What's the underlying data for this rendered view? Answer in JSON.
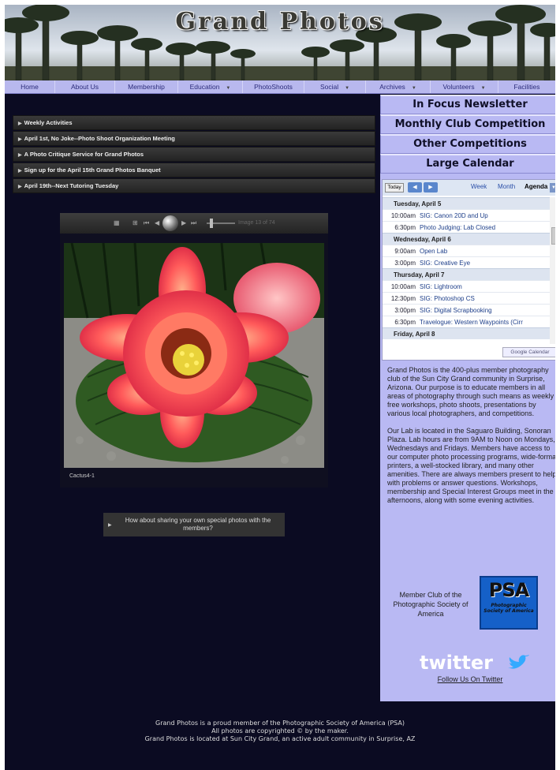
{
  "site": {
    "title": "Grand Photos"
  },
  "nav": {
    "items": [
      {
        "label": "Home",
        "has_dropdown": false
      },
      {
        "label": "About Us",
        "has_dropdown": false
      },
      {
        "label": "Membership",
        "has_dropdown": false
      },
      {
        "label": "Education",
        "has_dropdown": true
      },
      {
        "label": "PhotoShoots",
        "has_dropdown": false
      },
      {
        "label": "Social",
        "has_dropdown": true
      },
      {
        "label": "Archives",
        "has_dropdown": true
      },
      {
        "label": "Volunteers",
        "has_dropdown": true
      },
      {
        "label": "Facilities",
        "has_dropdown": false
      }
    ]
  },
  "accordion": {
    "items": [
      "Weekly Activities",
      "April 1st, No Joke--Photo Shoot Organization Meeting",
      "A Photo Critique Service for Grand Photos",
      "Sign up for the April 15th Grand Photos Banquet",
      "April 19th--Next Tutoring Tuesday"
    ]
  },
  "slideshow": {
    "counter": "Image 13 of 74",
    "caption": "Cactus4-1"
  },
  "share_box": {
    "text": "How about sharing your own special photos with the members?"
  },
  "sidebar": {
    "buttons": [
      "In Focus Newsletter",
      "Monthly Club Competition",
      "Other Competitions",
      "Large Calendar"
    ]
  },
  "calendar": {
    "today_label": "Today",
    "view_week": "Week",
    "view_month": "Month",
    "view_agenda": "Agenda",
    "badge": "Google Calendar",
    "days": [
      {
        "date": "Tuesday, April 5",
        "events": [
          {
            "time": "10:00am",
            "title": "SIG: Canon 20D and Up"
          },
          {
            "time": "6:30pm",
            "title": "Photo Judging: Lab Closed"
          }
        ]
      },
      {
        "date": "Wednesday, April 6",
        "events": [
          {
            "time": "9:00am",
            "title": "Open Lab"
          },
          {
            "time": "3:00pm",
            "title": "SIG: Creative Eye"
          }
        ]
      },
      {
        "date": "Thursday, April 7",
        "events": [
          {
            "time": "10:00am",
            "title": "SIG: Lightroom"
          },
          {
            "time": "12:30pm",
            "title": "SIG: Photoshop CS"
          },
          {
            "time": "3:00pm",
            "title": "SIG: Digital Scrapbooking"
          },
          {
            "time": "6:30pm",
            "title": "Travelogue: Western Waypoints (Cirr"
          }
        ]
      },
      {
        "date": "Friday, April 8",
        "events": []
      }
    ]
  },
  "about": {
    "paragraphs": [
      "Grand Photos is the 400-plus member photography club of  the Sun City Grand community in Surprise, Arizona. Our purpose is to educate members in all areas of photography through such means as weekly free workshops, photo shoots, presentations by various local photographers, and competitions.",
      "Our Lab is located in the Saguaro Building, Sonoran Plaza.  Lab hours are from 9AM to Noon on Mondays, Wednesdays and Fridays.  Members have access to our computer photo processing programs, wide-format printers, a well-stocked  library, and many other amenities.  There are always members present to help with problems or answer questions.  Workshops, membership and Special Interest Groups meet in the afternoons, along with some evening activities."
    ]
  },
  "psa": {
    "label": "Member Club of the Photographic Society of America",
    "logo_big": "PSA",
    "logo_small": "Photographic Society of America"
  },
  "twitter": {
    "logo": "twitter",
    "link": "Follow Us On Twitter"
  },
  "footer": {
    "lines": [
      "Grand Photos is a proud member of the Photographic Society of America (PSA)",
      "All photos are copyrighted © by the maker.",
      "Grand Photos is located at Sun City Grand, an active adult community in Surprise, AZ"
    ]
  },
  "colors": {
    "page_bg": "#0b0b22",
    "nav_bg": "#b8b8ee",
    "sidebar_bg": "#b9b9f3",
    "accordion_bg": "#2d2d2d"
  }
}
